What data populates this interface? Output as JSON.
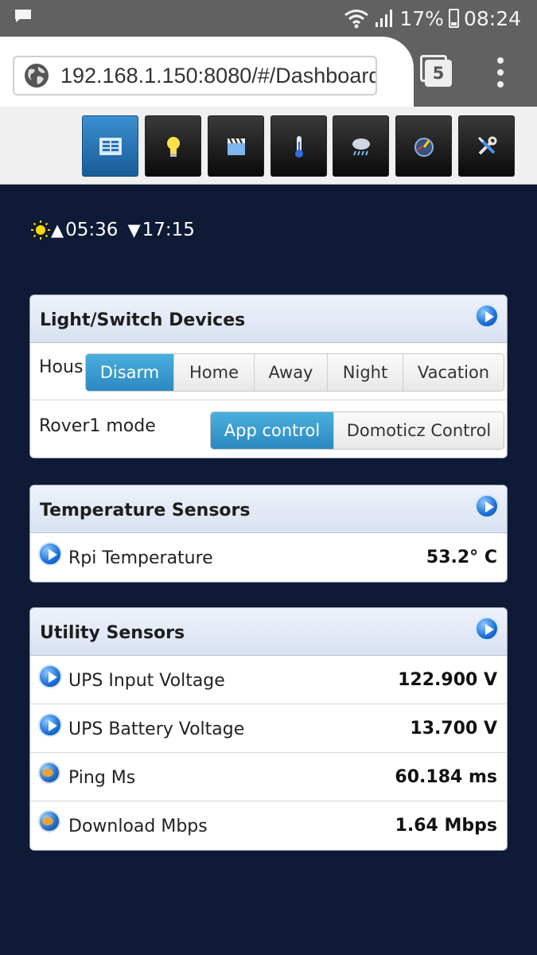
{
  "status_bar": {
    "battery": "17%",
    "time": "08:24"
  },
  "browser": {
    "url": "192.168.1.150:8080/#/Dashboard",
    "tab_count": "5"
  },
  "nav": {
    "items": [
      {
        "icon": "dashboard-icon",
        "active": true
      },
      {
        "icon": "lightbulb-icon",
        "active": false
      },
      {
        "icon": "scenes-clapper-icon",
        "active": false
      },
      {
        "icon": "thermometer-icon",
        "active": false
      },
      {
        "icon": "weather-icon",
        "active": false
      },
      {
        "icon": "utility-gauge-icon",
        "active": false
      },
      {
        "icon": "setup-tools-icon",
        "active": false
      }
    ]
  },
  "sun": {
    "sunrise": "05:36",
    "sunset": "17:15"
  },
  "switch_panel": {
    "title": "Light/Switch Devices",
    "house_label": "Hous",
    "house_options": [
      "Disarm",
      "Home",
      "Away",
      "Night",
      "Vacation"
    ],
    "house_selected": "Disarm",
    "rover_label": "Rover1 mode",
    "rover_options": [
      "App control",
      "Domoticz Control"
    ],
    "rover_selected": "App control"
  },
  "temp_panel": {
    "title": "Temperature Sensors",
    "rows": [
      {
        "label": "Rpi Temperature",
        "value": "53.2° C"
      }
    ]
  },
  "utility_panel": {
    "title": "Utility Sensors",
    "rows": [
      {
        "label": "UPS Input Voltage",
        "value": "122.900 V",
        "icon": "play-icon"
      },
      {
        "label": "UPS Battery Voltage",
        "value": "13.700 V",
        "icon": "play-icon"
      },
      {
        "label": "Ping Ms",
        "value": "60.184 ms",
        "icon": "globe-icon"
      },
      {
        "label": "Download Mbps",
        "value": "1.64 Mbps",
        "icon": "globe-icon"
      }
    ]
  },
  "colors": {
    "background": "#0e1a36",
    "accent": "#2c88c1",
    "panel_header": "#d9e1f1"
  }
}
